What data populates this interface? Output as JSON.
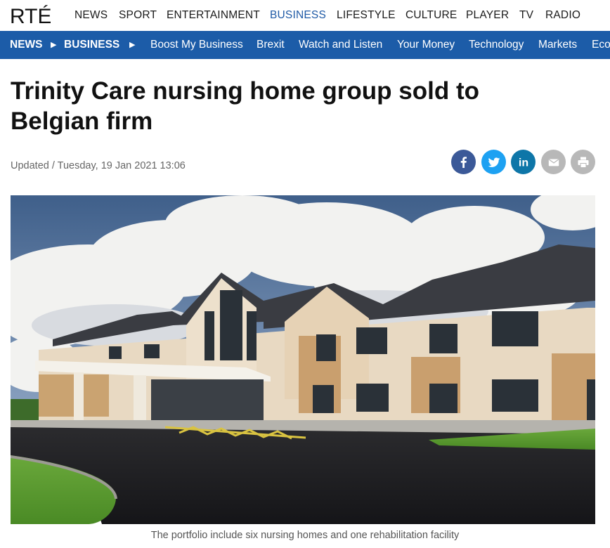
{
  "topnav": {
    "logo_text": "RTÉ",
    "items": [
      {
        "label": "News"
      },
      {
        "label": "Sport"
      },
      {
        "label": "Entertainment"
      },
      {
        "label": "Business"
      },
      {
        "label": "Lifestyle"
      },
      {
        "label": "Culture"
      },
      {
        "label": "Player"
      },
      {
        "label": "TV"
      },
      {
        "label": "Radio"
      }
    ],
    "active": "Business"
  },
  "subnav": {
    "breadcrumb": [
      "NEWS",
      "BUSINESS"
    ],
    "links": [
      "Boost My Business",
      "Brexit",
      "Watch and Listen",
      "Your Money",
      "Technology",
      "Markets",
      "Eco"
    ]
  },
  "article": {
    "headline": "Trinity Care nursing home group sold to Belgian firm",
    "updated": "Updated / Tuesday, 19 Jan 2021 13:06",
    "caption": "The portfolio include six nursing homes and one rehabilitation facility"
  },
  "share": [
    {
      "name": "facebook-icon",
      "color": "#3b5998"
    },
    {
      "name": "twitter-icon",
      "color": "#1da1f2"
    },
    {
      "name": "linkedin-icon",
      "color": "#0e76a8"
    },
    {
      "name": "email-icon",
      "color": "#b8b8b8"
    },
    {
      "name": "print-icon",
      "color": "#b8b8b8"
    }
  ],
  "colors": {
    "brand_blue": "#1c5ca8",
    "active_nav": "#1f5aa6"
  }
}
